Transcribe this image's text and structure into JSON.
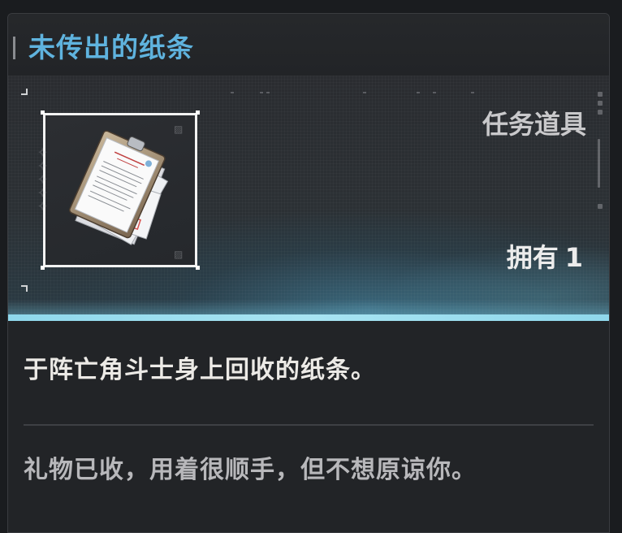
{
  "item": {
    "name": "未传出的纸条",
    "type": "任务道具",
    "owned_label": "拥有",
    "owned_count": "1",
    "description": "于阵亡角斗士身上回收的纸条。",
    "flavor_text": "礼物已收，用着很顺手，但不想原谅你。",
    "icon": "paper-notes-icon"
  },
  "colors": {
    "title": "#5fb3de",
    "accent_stripe": "#a8e4f2",
    "panel_bg": "#222427"
  }
}
